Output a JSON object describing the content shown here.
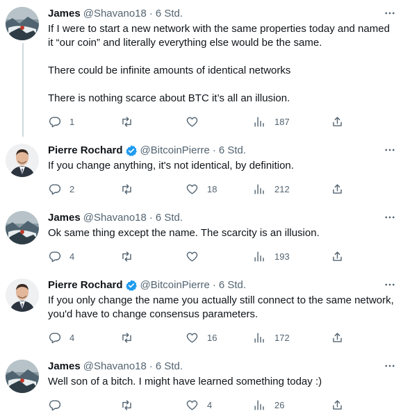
{
  "tweets": [
    {
      "name": "James",
      "handle": "@Shavano18",
      "sep": "·",
      "time": "6 Std.",
      "verified": false,
      "lines": [
        "If I were to start a new network with the same properties today and named it “our coin” and literally everything else would be the same.",
        "There could be infinite amounts of identical networks",
        "There is nothing scarce about BTC it’s all an illusion."
      ],
      "replies": "1",
      "retweets": "",
      "likes": "",
      "views": "187"
    },
    {
      "name": "Pierre Rochard",
      "handle": "@BitcoinPierre",
      "sep": "·",
      "time": "6 Std.",
      "verified": true,
      "lines": [
        "If you change anything, it's not identical, by definition."
      ],
      "replies": "2",
      "retweets": "",
      "likes": "18",
      "views": "212"
    },
    {
      "name": "James",
      "handle": "@Shavano18",
      "sep": "·",
      "time": "6 Std.",
      "verified": false,
      "lines": [
        "Ok same thing except the name.  The scarcity is an illusion."
      ],
      "replies": "4",
      "retweets": "",
      "likes": "",
      "views": "193"
    },
    {
      "name": "Pierre Rochard",
      "handle": "@BitcoinPierre",
      "sep": "·",
      "time": "6 Std.",
      "verified": true,
      "lines": [
        "If you only change the name you actually still connect to the same network, you'd have to change consensus parameters."
      ],
      "replies": "4",
      "retweets": "",
      "likes": "16",
      "views": "172"
    },
    {
      "name": "James",
      "handle": "@Shavano18",
      "sep": "·",
      "time": "6 Std.",
      "verified": false,
      "lines": [
        "Well son of a bitch.  I might have learned something today :)"
      ],
      "replies": "",
      "retweets": "",
      "likes": "4",
      "views": "26"
    }
  ],
  "icons": {
    "reply": "reply-icon",
    "retweet": "retweet-icon",
    "like": "heart-icon",
    "views": "views-icon",
    "share": "share-icon",
    "more": "more-icon",
    "verified": "verified-badge-icon"
  },
  "colors": {
    "text": "#0f1419",
    "secondary": "#536471",
    "verified": "#1d9bf0",
    "connector": "#cfd9de"
  }
}
